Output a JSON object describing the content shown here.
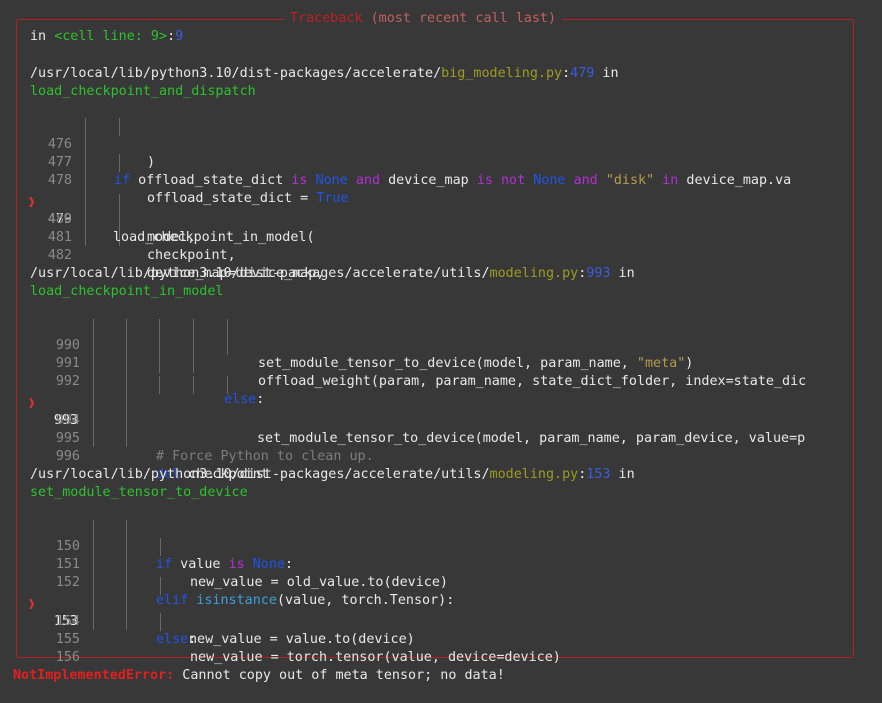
{
  "traceback": {
    "title": "Traceback",
    "subtitle": "(most recent call last)",
    "cell_prefix": "in ",
    "cell_ref": "<cell line: 9>",
    "cell_colon": ":",
    "cell_line": "9",
    "frames": [
      {
        "path": "/usr/local/lib/python3.10/dist-packages/accelerate/",
        "file": "big_modeling.py",
        "colon": ":",
        "line": "479",
        "in_word": " in",
        "func": "load_checkpoint_and_dispatch",
        "lines": [
          {
            "num": "476",
            "text": ")"
          },
          {
            "num": "477",
            "text": "if offload_state_dict is None and device_map is not None and \"disk\" in device_map.va"
          },
          {
            "num": "478",
            "text": "offload_state_dict = True"
          },
          {
            "num": "479",
            "text": "load_checkpoint_in_model(",
            "current": true
          },
          {
            "num": "480",
            "text": "model,"
          },
          {
            "num": "481",
            "text": "checkpoint,"
          },
          {
            "num": "482",
            "text": "device_map=device_map,"
          }
        ]
      },
      {
        "path": "/usr/local/lib/python3.10/dist-packages/accelerate/utils/",
        "file": "modeling.py",
        "colon": ":",
        "line": "993",
        "in_word": " in",
        "func": "load_checkpoint_in_model",
        "lines": [
          {
            "num": "990",
            "text": "set_module_tensor_to_device(model, param_name, \"meta\")"
          },
          {
            "num": "991",
            "text": "offload_weight(param, param_name, state_dict_folder, index=state_dic"
          },
          {
            "num": "992",
            "text": "else:"
          },
          {
            "num": "993",
            "text": "set_module_tensor_to_device(model, param_name, param_device, value=p",
            "current": true
          },
          {
            "num": "994",
            "text": ""
          },
          {
            "num": "995",
            "text": "# Force Python to clean up."
          },
          {
            "num": "996",
            "text": "del checkpoint"
          }
        ]
      },
      {
        "path": "/usr/local/lib/python3.10/dist-packages/accelerate/utils/",
        "file": "modeling.py",
        "colon": ":",
        "line": "153",
        "in_word": " in",
        "func": "set_module_tensor_to_device",
        "lines": [
          {
            "num": "150",
            "text": "if value is None:"
          },
          {
            "num": "151",
            "text": "new_value = old_value.to(device)"
          },
          {
            "num": "152",
            "text": "elif isinstance(value, torch.Tensor):"
          },
          {
            "num": "153",
            "text": "new_value = value.to(device)",
            "current": true
          },
          {
            "num": "154",
            "text": "else:"
          },
          {
            "num": "155",
            "text": "new_value = torch.tensor(value, device=device)"
          },
          {
            "num": "156",
            "text": ""
          }
        ]
      }
    ]
  },
  "error": {
    "type": "NotImplementedError:",
    "message": " Cannot copy out of meta tensor; no data!"
  },
  "marker_glyph": "❱",
  "colors": {
    "background": "#383838",
    "border": "#b32121",
    "error": "#e02020",
    "keyword": "#b22fd6",
    "constant": "#1f55e8",
    "string": "#b39c4d",
    "function_name": "#2ec22e",
    "file_name": "#9c9c23"
  }
}
